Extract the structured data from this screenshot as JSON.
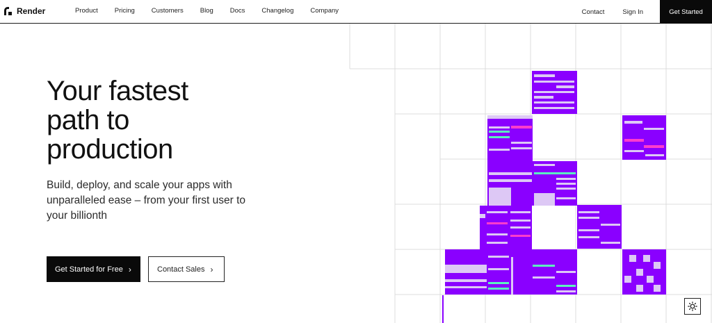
{
  "nav": {
    "brand": "Render",
    "links": [
      "Product",
      "Pricing",
      "Customers",
      "Blog",
      "Docs",
      "Changelog",
      "Company"
    ],
    "contact": "Contact",
    "sign_in": "Sign In",
    "get_started": "Get Started"
  },
  "hero": {
    "headline": "Your fastest path to production",
    "subheadline": "Build, deploy, and scale your apps with unparalleled ease – from your first user to your billionth",
    "primary_cta": "Get Started for Free",
    "secondary_cta": "Contact Sales"
  },
  "theme_toggle_icon": "sun-icon",
  "colors": {
    "accent": "#8a00ff",
    "accent_light": "#ddc8f5",
    "magenta": "#ff3dcc",
    "mint": "#5cf2c0",
    "grid_line": "#dcdcdc"
  }
}
